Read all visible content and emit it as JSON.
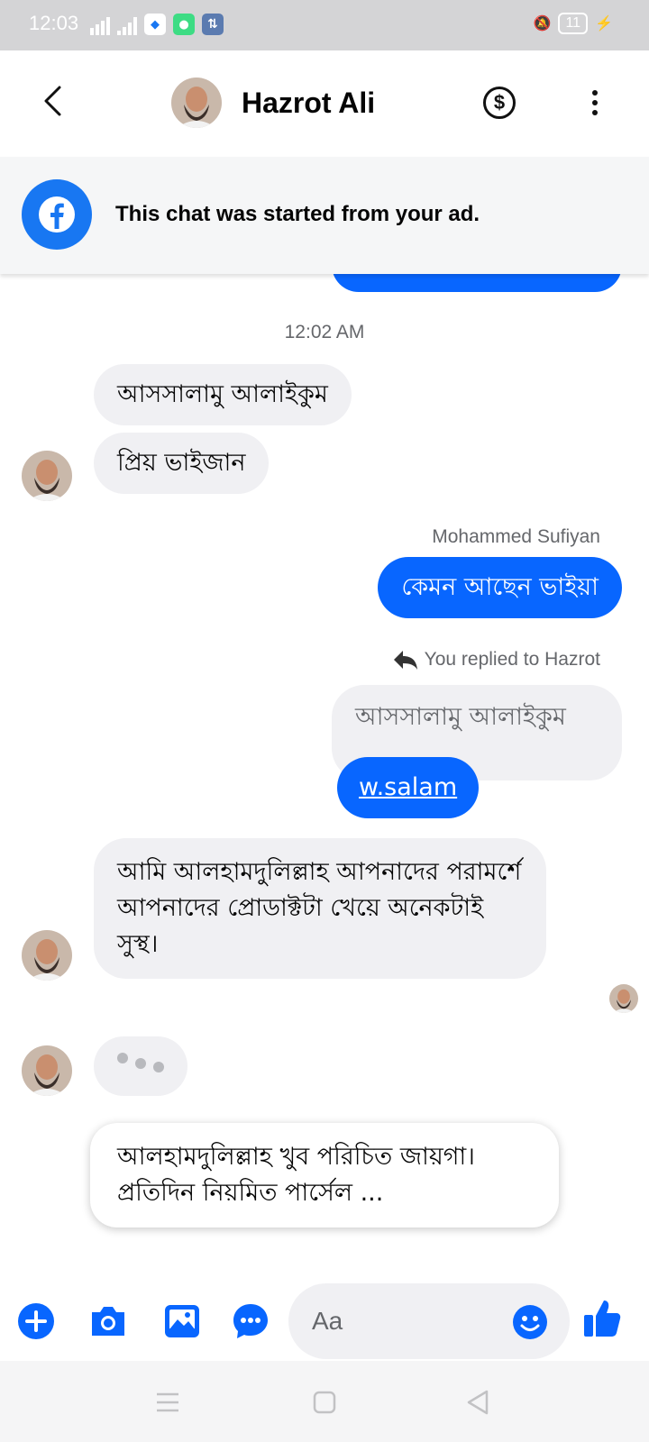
{
  "status_bar": {
    "time": "12:03",
    "battery": "11",
    "icons": [
      "wifi-signal-icon",
      "cell-signal-icon",
      "app-notification-icon",
      "app-notification-icon",
      "data-transfer-icon",
      "mute-vibrate-icon",
      "charging-icon"
    ]
  },
  "header": {
    "contact_name": "Hazrot Ali",
    "back_icon": "chevron-left-icon",
    "payment_icon": "dollar-circle-icon",
    "more_icon": "vertical-dots-icon"
  },
  "ad_banner": {
    "text": "This chat was started from your ad.",
    "icon": "facebook-icon"
  },
  "chat": {
    "timestamp": "12:02 AM",
    "messages": [
      {
        "direction": "in",
        "text": "আসসালামু আলাইকুম"
      },
      {
        "direction": "in",
        "text": "প্রিয় ভাইজান"
      },
      {
        "direction": "out",
        "sender": "Mohammed Sufiyan",
        "text": "কেমন আছেন ভাইয়া"
      },
      {
        "direction": "out",
        "reply_label": "You replied to Hazrot",
        "quoted_text": "আসসালামু আলাইকুম",
        "text": "w.salam"
      },
      {
        "direction": "in",
        "text": "আমি আলহামদুলিল্লাহ আপনাদের পরামর্শে আপনাদের প্রোডাক্টটা খেয়ে অনেকটাই সুস্থ।"
      }
    ],
    "draft_preview": "আলহামদুলিল্লাহ খুব পরিচিত জায়গা। প্রতিদিন নিয়মিত পার্সেল ...",
    "typing_indicator": "typing-dots-icon"
  },
  "composer": {
    "placeholder": "Aa",
    "icons": [
      "plus-circle-icon",
      "camera-icon",
      "gallery-icon",
      "chat-bubble-icon",
      "emoji-icon",
      "thumbs-up-icon"
    ]
  },
  "colors": {
    "accent": "#0866ff",
    "incoming_bubble": "#f0f0f3",
    "facebook_blue": "#1877f2",
    "status_bar": "#d4d4d6"
  }
}
